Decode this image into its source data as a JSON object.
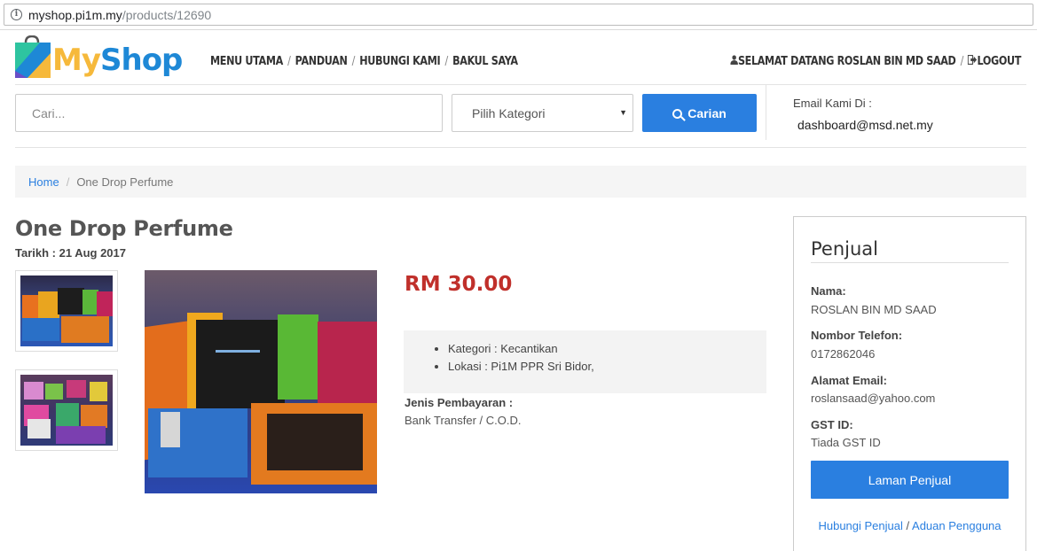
{
  "browser": {
    "url_host": "myshop.pi1m.my",
    "url_path": "/products/12690"
  },
  "header": {
    "logo_my": "My",
    "logo_shop": "Shop",
    "nav": [
      "MENU UTAMA",
      "PANDUAN",
      "HUBUNGI KAMI",
      "BAKUL SAYA"
    ],
    "nav_separator": "/",
    "welcome": "SELAMAT DATANG ROSLAN BIN MD SAAD",
    "logout": "LOGOUT"
  },
  "search": {
    "placeholder": "Cari...",
    "category_selected": "Pilih Kategori",
    "button_label": "Carian",
    "email_label": "Email Kami Di :",
    "email_value": "dashboard@msd.net.my"
  },
  "breadcrumb": {
    "home": "Home",
    "current": "One Drop Perfume"
  },
  "product": {
    "title": "One Drop Perfume",
    "date": "Tarikh : 21 Aug 2017",
    "price": "RM 30.00",
    "details": [
      "Kategori : Kecantikan",
      "Lokasi : Pi1M PPR Sri Bidor,"
    ],
    "payment_label": "Jenis Pembayaran :",
    "payment_value": "Bank Transfer / C.O.D."
  },
  "seller": {
    "heading": "Penjual",
    "name_label": "Nama:",
    "name_value": "ROSLAN BIN MD SAAD",
    "phone_label": "Nombor Telefon:",
    "phone_value": "0172862046",
    "email_label": "Alamat Email:",
    "email_value": "roslansaad@yahoo.com",
    "gst_label": "GST ID:",
    "gst_value": "Tiada GST ID",
    "page_button": "Laman Penjual",
    "contact_link": "Hubungi Penjual",
    "link_separator": "/",
    "report_link": "Aduan Pengguna"
  },
  "colors": {
    "accent": "#2a7fe0",
    "price": "#c0302b",
    "logo_yellow": "#f6b93b",
    "logo_blue": "#1e88d6"
  }
}
